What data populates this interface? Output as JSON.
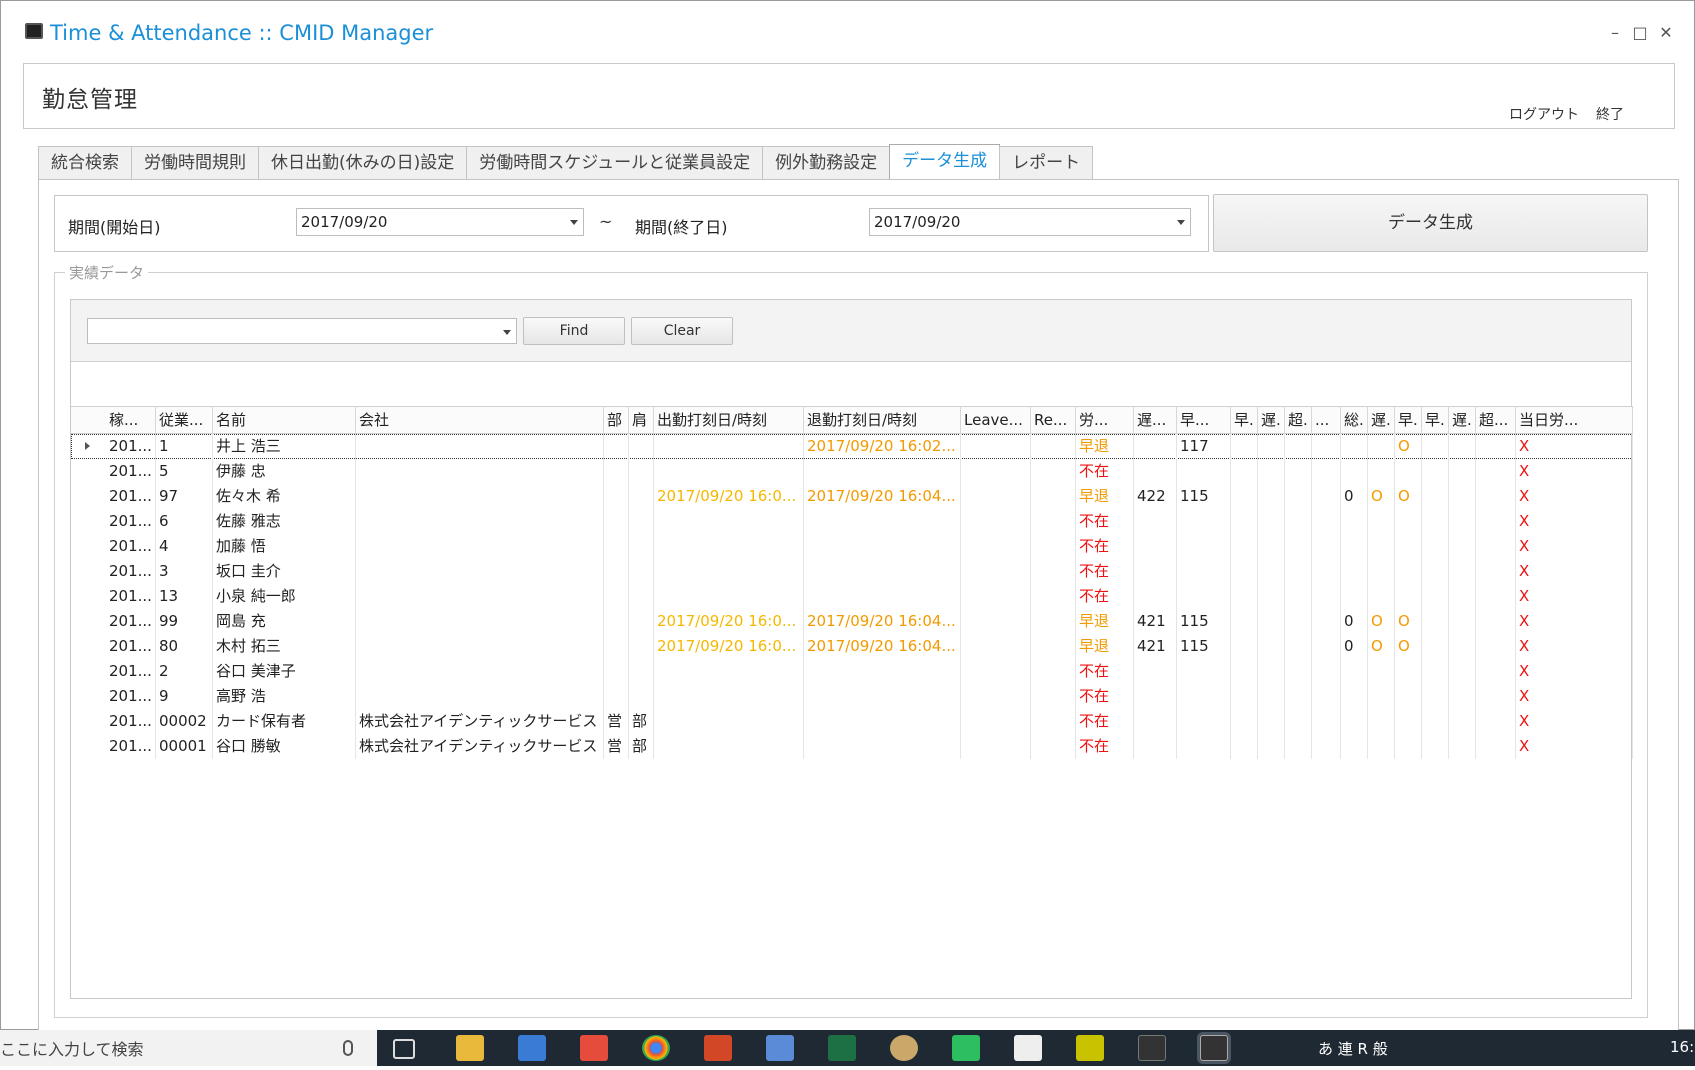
{
  "window": {
    "title": "Time & Attendance :: CMID Manager",
    "controls": {
      "minimize": "–",
      "maximize": "□",
      "close": "✕"
    }
  },
  "header": {
    "title": "勤怠管理",
    "logout": "ログアウト",
    "exit": "終了"
  },
  "tabs": [
    "統合検索",
    "労働時間規則",
    "休日出勤(休みの日)設定",
    "労働時間スケジュールと従業員設定",
    "例外勤務設定",
    "データ生成",
    "レポート"
  ],
  "period": {
    "start_label": "期間(開始日)",
    "start_value": "2017/09/20",
    "tilde": "~",
    "end_label": "期間(終了日)",
    "end_value": "2017/09/20",
    "generate_button": "データ生成"
  },
  "results": {
    "group_label": "実績データ",
    "find_button": "Find",
    "clear_button": "Clear",
    "columns": [
      "稼...",
      "従業...",
      "名前",
      "会社",
      "部",
      "肩",
      "出勤打刻日/時刻",
      "退勤打刻日/時刻",
      "Leave...",
      "Re...",
      "労...",
      "遅...",
      "早...",
      "早.",
      "遅.",
      "超.",
      "...",
      "総.",
      "遅.",
      "早.",
      "早.",
      "遅.",
      "超...",
      "当日労..."
    ],
    "rows": [
      {
        "c0": "201...",
        "c1": "1",
        "c2": "井上 浩三",
        "c3": "",
        "c4": "",
        "c5": "",
        "c6": "",
        "c7": "2017/09/20 16:02...",
        "c10": "早退",
        "c11": "",
        "c12": "117",
        "c17": "",
        "c18": "",
        "c19": "O",
        "c23": "X"
      },
      {
        "c0": "201...",
        "c1": "5",
        "c2": "伊藤 忠",
        "c3": "",
        "c4": "",
        "c5": "",
        "c6": "",
        "c7": "",
        "c10": "不在",
        "c11": "",
        "c12": "",
        "c17": "",
        "c18": "",
        "c19": "",
        "c23": "X"
      },
      {
        "c0": "201...",
        "c1": "97",
        "c2": "佐々木 希",
        "c3": "",
        "c4": "",
        "c5": "",
        "c6": "2017/09/20 16:0...",
        "c7": "2017/09/20 16:04...",
        "c10": "早退",
        "c11": "422",
        "c12": "115",
        "c17": "0",
        "c18": "O",
        "c19": "O",
        "c23": "X"
      },
      {
        "c0": "201...",
        "c1": "6",
        "c2": "佐藤 雅志",
        "c3": "",
        "c4": "",
        "c5": "",
        "c6": "",
        "c7": "",
        "c10": "不在",
        "c11": "",
        "c12": "",
        "c17": "",
        "c18": "",
        "c19": "",
        "c23": "X"
      },
      {
        "c0": "201...",
        "c1": "4",
        "c2": "加藤 悟",
        "c3": "",
        "c4": "",
        "c5": "",
        "c6": "",
        "c7": "",
        "c10": "不在",
        "c11": "",
        "c12": "",
        "c17": "",
        "c18": "",
        "c19": "",
        "c23": "X"
      },
      {
        "c0": "201...",
        "c1": "3",
        "c2": "坂口 圭介",
        "c3": "",
        "c4": "",
        "c5": "",
        "c6": "",
        "c7": "",
        "c10": "不在",
        "c11": "",
        "c12": "",
        "c17": "",
        "c18": "",
        "c19": "",
        "c23": "X"
      },
      {
        "c0": "201...",
        "c1": "13",
        "c2": "小泉 純一郎",
        "c3": "",
        "c4": "",
        "c5": "",
        "c6": "",
        "c7": "",
        "c10": "不在",
        "c11": "",
        "c12": "",
        "c17": "",
        "c18": "",
        "c19": "",
        "c23": "X"
      },
      {
        "c0": "201...",
        "c1": "99",
        "c2": "岡島 充",
        "c3": "",
        "c4": "",
        "c5": "",
        "c6": "2017/09/20 16:0...",
        "c7": "2017/09/20 16:04...",
        "c10": "早退",
        "c11": "421",
        "c12": "115",
        "c17": "0",
        "c18": "O",
        "c19": "O",
        "c23": "X"
      },
      {
        "c0": "201...",
        "c1": "80",
        "c2": "木村 拓三",
        "c3": "",
        "c4": "",
        "c5": "",
        "c6": "2017/09/20 16:0...",
        "c7": "2017/09/20 16:04...",
        "c10": "早退",
        "c11": "421",
        "c12": "115",
        "c17": "0",
        "c18": "O",
        "c19": "O",
        "c23": "X"
      },
      {
        "c0": "201...",
        "c1": "2",
        "c2": "谷口 美津子",
        "c3": "",
        "c4": "",
        "c5": "",
        "c6": "",
        "c7": "",
        "c10": "不在",
        "c11": "",
        "c12": "",
        "c17": "",
        "c18": "",
        "c19": "",
        "c23": "X"
      },
      {
        "c0": "201...",
        "c1": "9",
        "c2": "高野 浩",
        "c3": "",
        "c4": "",
        "c5": "",
        "c6": "",
        "c7": "",
        "c10": "不在",
        "c11": "",
        "c12": "",
        "c17": "",
        "c18": "",
        "c19": "",
        "c23": "X"
      },
      {
        "c0": "201...",
        "c1": "00002",
        "c2": "カード保有者",
        "c3": "株式会社アイデンティックサービス",
        "c4": "営",
        "c5": "部",
        "c6": "",
        "c7": "",
        "c10": "不在",
        "c11": "",
        "c12": "",
        "c17": "",
        "c18": "",
        "c19": "",
        "c23": "X"
      },
      {
        "c0": "201...",
        "c1": "00001",
        "c2": "谷口 勝敏",
        "c3": "株式会社アイデンティックサービス",
        "c4": "営",
        "c5": "部",
        "c6": "",
        "c7": "",
        "c10": "不在",
        "c11": "",
        "c12": "",
        "c17": "",
        "c18": "",
        "c19": "",
        "c23": "X"
      }
    ]
  },
  "taskbar": {
    "search_placeholder": "ここに入力して検索",
    "tray_text": "あ 連 R 般",
    "clock": "16:"
  },
  "colors": {
    "accent": "#1b8fd8",
    "orange": "#f39a00",
    "yellow": "#f5b800",
    "red": "#ee1111"
  }
}
